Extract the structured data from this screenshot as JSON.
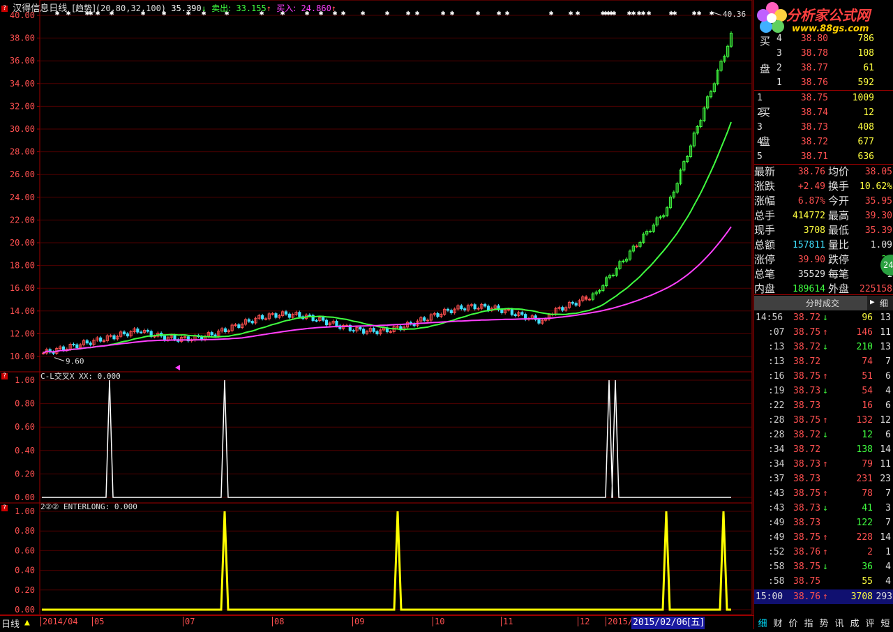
{
  "header": {
    "stock_name": "汉得信息",
    "period": "日线",
    "indicator": "[趋势]",
    "params": "(20,80,32,100)",
    "value": "35.390",
    "value_arrow": "↓",
    "sell_label": "卖出:",
    "sell_value": "33.155",
    "sell_arrow": "↑",
    "buy_label": "买入:",
    "buy_value": "24.860",
    "buy_arrow": "↑"
  },
  "main_axis": {
    "ticks": [
      "40.00",
      "38.00",
      "36.00",
      "34.00",
      "32.00",
      "30.00",
      "28.00",
      "26.00",
      "24.00",
      "22.00",
      "20.00",
      "18.00",
      "16.00",
      "14.00",
      "12.00",
      "10.00"
    ],
    "high_label": "40.36",
    "low_label": "9.60"
  },
  "panel2": {
    "title": "C-L交叉X  XX: 0.000",
    "ticks": [
      "1.00",
      "0.80",
      "0.60",
      "0.40",
      "0.20",
      "0.00"
    ]
  },
  "panel3": {
    "title": "2②②  ENTERLONG: 0.000",
    "ticks": [
      "1.00",
      "0.80",
      "0.60",
      "0.40",
      "0.20",
      "0.00"
    ]
  },
  "bottom_bar": {
    "period_label": "日线",
    "months": [
      "2014/04",
      "05",
      "07",
      "08",
      "09",
      "10",
      "11",
      "12",
      "2015/"
    ],
    "current_date": "2015/02/06",
    "weekday": "[五]"
  },
  "logo": {
    "brand": "分析家公式网",
    "url": "www.88gs.com"
  },
  "order_book": {
    "sell_label": "卖盘",
    "buy_label": "买盘",
    "sell": [
      {
        "idx": "4",
        "price": "38.80",
        "vol": "786"
      },
      {
        "idx": "3",
        "price": "38.78",
        "vol": "108"
      },
      {
        "idx": "2",
        "price": "38.77",
        "vol": "61"
      },
      {
        "idx": "1",
        "price": "38.76",
        "vol": "592"
      }
    ],
    "buy": [
      {
        "idx": "1",
        "price": "38.75",
        "vol": "1009"
      },
      {
        "idx": "2",
        "price": "38.74",
        "vol": "12"
      },
      {
        "idx": "3",
        "price": "38.73",
        "vol": "408"
      },
      {
        "idx": "4",
        "price": "38.72",
        "vol": "677"
      },
      {
        "idx": "5",
        "price": "38.71",
        "vol": "636"
      }
    ]
  },
  "stats": [
    {
      "l1": "最新",
      "v1": "38.76",
      "c1": "#ff5050",
      "l2": "均价",
      "v2": "38.05",
      "c2": "#ff5050"
    },
    {
      "l1": "涨跌",
      "v1": "+2.49",
      "c1": "#ff5050",
      "l2": "换手",
      "v2": "10.62%",
      "c2": "#ffff40"
    },
    {
      "l1": "涨幅",
      "v1": "6.87%",
      "c1": "#ff5050",
      "l2": "今开",
      "v2": "35.95",
      "c2": "#ff5050"
    },
    {
      "l1": "总手",
      "v1": "414772",
      "c1": "#ffff40",
      "l2": "最高",
      "v2": "39.30",
      "c2": "#ff5050"
    },
    {
      "l1": "现手",
      "v1": "3708",
      "c1": "#ffff40",
      "l2": "最低",
      "v2": "35.39",
      "c2": "#ff5050"
    },
    {
      "l1": "总额",
      "v1": "157811",
      "c1": "#40e0ff",
      "l2": "量比",
      "v2": "1.09",
      "c2": "#e0e0e0"
    },
    {
      "l1": "涨停",
      "v1": "39.90",
      "c1": "#ff5050",
      "l2": "跌停",
      "v2": "32",
      "c2": "#40ff40"
    },
    {
      "l1": "总笔",
      "v1": "35529",
      "c1": "#e0e0e0",
      "l2": "每笔",
      "v2": "1",
      "c2": "#e0e0e0"
    },
    {
      "l1": "内盘",
      "v1": "189614",
      "c1": "#40ff40",
      "l2": "外盘",
      "v2": "225158",
      "c2": "#ff5050"
    }
  ],
  "badge": "24",
  "trades_header": "分时成交",
  "trades_toggle": "细",
  "trades": [
    {
      "t": "14:56",
      "p": "38.72",
      "a": "↓",
      "v": "96",
      "n": "13",
      "vc": "#ffff40"
    },
    {
      "t": ":07",
      "p": "38.75",
      "a": "↑",
      "v": "146",
      "n": "11",
      "vc": "#ff5050"
    },
    {
      "t": ":13",
      "p": "38.72",
      "a": "↓",
      "v": "210",
      "n": "13",
      "vc": "#40ff40"
    },
    {
      "t": ":13",
      "p": "38.72",
      "a": "",
      "v": "74",
      "n": "7",
      "vc": "#ff5050"
    },
    {
      "t": ":16",
      "p": "38.75",
      "a": "↑",
      "v": "51",
      "n": "6",
      "vc": "#ff5050"
    },
    {
      "t": ":19",
      "p": "38.73",
      "a": "↓",
      "v": "54",
      "n": "4",
      "vc": "#ff5050"
    },
    {
      "t": ":22",
      "p": "38.73",
      "a": "",
      "v": "16",
      "n": "6",
      "vc": "#ff5050"
    },
    {
      "t": ":28",
      "p": "38.75",
      "a": "↑",
      "v": "132",
      "n": "12",
      "vc": "#ff5050"
    },
    {
      "t": ":28",
      "p": "38.72",
      "a": "↓",
      "v": "12",
      "n": "6",
      "vc": "#40ff40"
    },
    {
      "t": ":34",
      "p": "38.72",
      "a": "",
      "v": "138",
      "n": "14",
      "vc": "#40ff40"
    },
    {
      "t": ":34",
      "p": "38.73",
      "a": "↑",
      "v": "79",
      "n": "11",
      "vc": "#ff5050"
    },
    {
      "t": ":37",
      "p": "38.73",
      "a": "",
      "v": "231",
      "n": "23",
      "vc": "#ff5050"
    },
    {
      "t": ":43",
      "p": "38.75",
      "a": "↑",
      "v": "78",
      "n": "7",
      "vc": "#ff5050"
    },
    {
      "t": ":43",
      "p": "38.73",
      "a": "↓",
      "v": "41",
      "n": "3",
      "vc": "#40ff40"
    },
    {
      "t": ":49",
      "p": "38.73",
      "a": "",
      "v": "122",
      "n": "7",
      "vc": "#40ff40"
    },
    {
      "t": ":49",
      "p": "38.75",
      "a": "↑",
      "v": "228",
      "n": "14",
      "vc": "#ff5050"
    },
    {
      "t": ":52",
      "p": "38.76",
      "a": "↑",
      "v": "2",
      "n": "1",
      "vc": "#ff5050"
    },
    {
      "t": ":58",
      "p": "38.75",
      "a": "↓",
      "v": "36",
      "n": "4",
      "vc": "#40ff40"
    },
    {
      "t": ":58",
      "p": "38.75",
      "a": "",
      "v": "55",
      "n": "4",
      "vc": "#ffff40"
    }
  ],
  "last_trade": {
    "t": "15:00",
    "p": "38.76",
    "a": "↑",
    "v": "3708",
    "n": "293"
  },
  "tabs": [
    "细",
    "财",
    "价",
    "指",
    "势",
    "讯",
    "成",
    "评",
    "短"
  ],
  "colors": {
    "up": "#ff5050",
    "down": "#40ff40",
    "ma1": "#40ff40",
    "ma2": "#ff40ff",
    "signal1": "#ffffff",
    "signal2": "#ffff00",
    "grid": "#a00000"
  }
}
